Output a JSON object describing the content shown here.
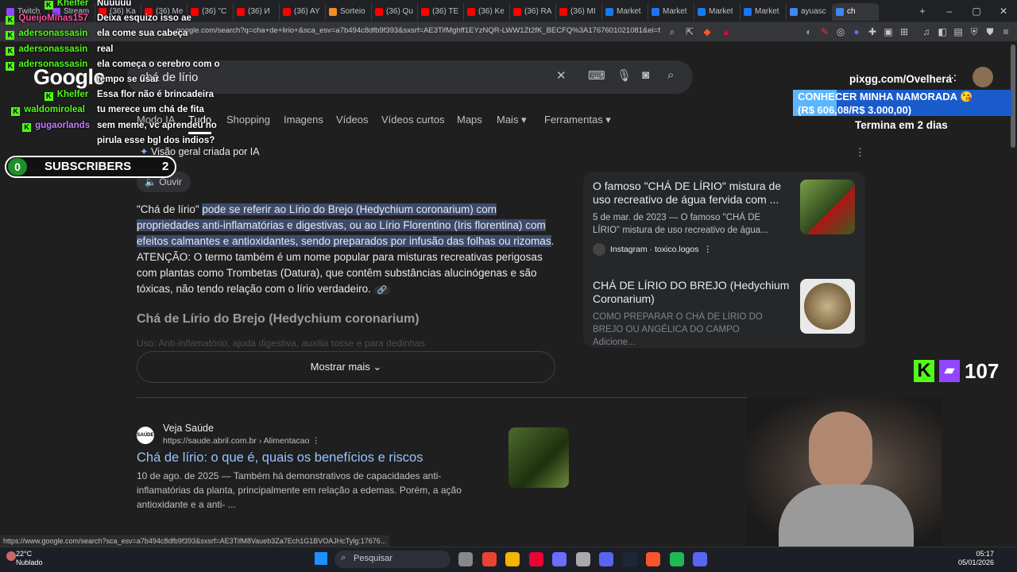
{
  "browser": {
    "tabs": [
      {
        "label": "Twitch",
        "color": "#9146ff"
      },
      {
        "label": "Stream",
        "color": "#9146ff"
      },
      {
        "label": "(36) Ka",
        "color": "#ff0000"
      },
      {
        "label": "(36) Me",
        "color": "#ff0000"
      },
      {
        "label": "(36) \"C",
        "color": "#ff0000"
      },
      {
        "label": "(36) И",
        "color": "#ff0000"
      },
      {
        "label": "(36) AY",
        "color": "#ff0000"
      },
      {
        "label": "Sorteio",
        "color": "#f28c28"
      },
      {
        "label": "(36) Qu",
        "color": "#ff0000"
      },
      {
        "label": "(36) TE",
        "color": "#ff0000"
      },
      {
        "label": "(36) Ke",
        "color": "#ff0000"
      },
      {
        "label": "(36) RA",
        "color": "#ff0000"
      },
      {
        "label": "(36) MI",
        "color": "#ff0000"
      },
      {
        "label": "Market",
        "color": "#1877f2"
      },
      {
        "label": "Market",
        "color": "#1877f2"
      },
      {
        "label": "Market",
        "color": "#1877f2"
      },
      {
        "label": "Market",
        "color": "#1877f2"
      },
      {
        "label": "ayuasc",
        "color": "#4285f4"
      },
      {
        "label": "ch",
        "color": "#4285f4"
      }
    ],
    "url": "google.com/search?q=cha+de+lirio+&sca_esv=a7b494c8dfb9f393&sxsrf=AE3TifMghff1EYzNQR-LWW1Zt2fK_BECFQ%3A1767601021081&ei=f..."
  },
  "google": {
    "logo": "Google",
    "query": "chá de lírio",
    "nav": [
      "Modo IA",
      "Tudo",
      "Shopping",
      "Imagens",
      "Vídeos",
      "Vídeos curtos",
      "Maps",
      "Mais ▾",
      "Ferramentas ▾"
    ],
    "ai_overview_label": "Visão geral criada por IA",
    "ouvir": "Ouvir",
    "ai_text_lead": "\"Chá de lírio\" ",
    "ai_text_highlight": "pode se referir ao Lírio do Brejo (Hedychium coronarium) com propriedades anti-inflamatórias e digestivas, ou ao Lírio Florentino (Iris florentina) com efeitos calmantes e antioxidantes, sendo preparados por infusão das folhas ou rizomas",
    "ai_text_rest": ". ATENÇÃO: O termo também é um nome popular para misturas recreativas perigosas com plantas como Trombetas (Datura), que contêm substâncias alucinógenas e são tóxicas, não tendo relação com o lírio verdadeiro.",
    "ai_heading": "Chá de Lírio do Brejo (Hedychium coronarium)",
    "ai_faded": "Uso: Anti-inflamatório, ajuda digestiva, auxilia tosse e para dedinhas",
    "mostrar_mais": "Mostrar mais",
    "cards": [
      {
        "title": "O famoso \"CHÁ DE LÍRIO\" mistura de uso recreativo de água fervida com ...",
        "desc": "5 de mar. de 2023 — O famoso \"CHÁ DE LÍRIO\" mistura de uso recreativo de água...",
        "source": "Instagram · toxico.logos"
      },
      {
        "title": "CHÁ DE LÍRIO DO BREJO (Hedychium Coronarium)",
        "desc": "COMO PREPARAR O CHÁ DE LÍRIO DO BREJO OU ANGÉLICA DO CAMPO Adicione..."
      }
    ],
    "result": {
      "site": "Veja Saúde",
      "favicon": "SAÚDE",
      "url": "https://saude.abril.com.br › Alimentacao",
      "title": "Chá de lírio: o que é, quais os benefícios e riscos",
      "desc": "10 de ago. de 2025 — Também há demonstrativos de capacidades anti-inflamatórias da planta, principalmente em relação a edemas. Porém, a ação antioxidante e a anti- ..."
    },
    "status_url": "https://www.google.com/search?sca_esv=a7b494c8dfb9f393&sxsrf=AE3TifM8Vaueb3Za7Ech1G1BVOAJHcTylg:17676..."
  },
  "chat": [
    {
      "user": "Khelfer",
      "color": "#53fc18",
      "msg": "Nuuuuu"
    },
    {
      "user": "QueijoMinas157",
      "color": "#ff4fa3",
      "msg": "Deixa esquizo isso ae"
    },
    {
      "user": "adersonassasin",
      "color": "#53fc18",
      "msg": "ela come sua cabeça"
    },
    {
      "user": "adersonassasin",
      "color": "#53fc18",
      "msg": "real"
    },
    {
      "user": "adersonassasin",
      "color": "#53fc18",
      "msg": "ela começa o cerebro com o"
    },
    {
      "user": "",
      "color": "#53fc18",
      "msg": "tempo se usar"
    },
    {
      "user": "Khelfer",
      "color": "#53fc18",
      "msg": "Essa flor não é brincadeira"
    },
    {
      "user": "waldomiroleal",
      "color": "#53fc18",
      "msg": "tu merece um chá de fita"
    },
    {
      "user": "gugaorlands",
      "color": "#c77dff",
      "msg": "sem meme, vc aprendeu no"
    },
    {
      "user": "",
      "color": "#c77dff",
      "msg": "pirula esse bgl dos indios?"
    }
  ],
  "subscribers": {
    "left": "0",
    "label": "SUBSCRIBERS",
    "count": "2"
  },
  "overlay": {
    "pix": "pixgg.com/Ovelhera",
    "goal_title": "CONHECER MINHA NAMORADA 😘",
    "goal_amount": "(R$ 606,08/R$ 3.000,00)",
    "goal_progress": 0.2,
    "termina": "Termina em 2 dias",
    "viewers": "107"
  },
  "taskbar": {
    "temp": "22°C",
    "weather": "Nublado",
    "search": "Pesquisar",
    "time": "05:17",
    "date": "05/01/2026"
  }
}
